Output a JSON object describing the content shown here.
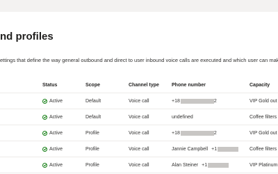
{
  "page": {
    "title": "nd profiles",
    "description": "ettings that define the way general outbound and direct to user inbound voice calls are executed and which user can make or"
  },
  "table": {
    "headers": {
      "status": "Status",
      "scope": "Scope",
      "channel": "Channel type",
      "phone": "Phone number",
      "capacity": "Capacity"
    },
    "rows": [
      {
        "status": "Active",
        "scope": "Default",
        "channel": "Voice call",
        "phone_prefix": "+18",
        "phone_suffix": "2",
        "person": "",
        "capacity": "VIP Gold out"
      },
      {
        "status": "Active",
        "scope": "Default",
        "channel": "Voice call",
        "phone_prefix": "undefined",
        "phone_suffix": "",
        "person": "",
        "capacity": "Coffee filters"
      },
      {
        "status": "Active",
        "scope": "Profile",
        "channel": "Voice call",
        "phone_prefix": "+18",
        "phone_suffix": "2",
        "person": "",
        "capacity": "VIP Gold out"
      },
      {
        "status": "Active",
        "scope": "Profile",
        "channel": "Voice call",
        "phone_prefix": "+1",
        "phone_suffix": "",
        "person": "Jannie Campbell",
        "capacity": "Coffee filters"
      },
      {
        "status": "Active",
        "scope": "Profile",
        "channel": "Voice call",
        "phone_prefix": "+1",
        "phone_suffix": "",
        "person": "Alan Steiner",
        "capacity": "VIP Platinum"
      }
    ]
  },
  "colors": {
    "status_active": "#107c10",
    "accent": "#0078d4"
  }
}
